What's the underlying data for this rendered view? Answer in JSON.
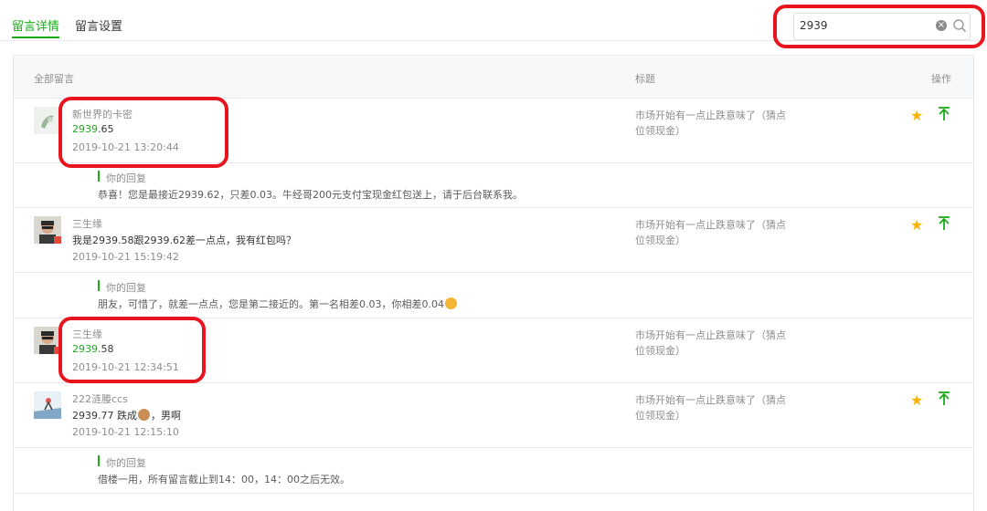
{
  "tabs": {
    "active": "留言详情",
    "settings": "留言设置"
  },
  "search": {
    "value": "2939"
  },
  "table_header": {
    "all_comments": "全部留言",
    "title": "标题",
    "actions": "操作"
  },
  "comments": [
    {
      "user": "新世界的卡密",
      "content_highlight": "2939",
      "content_rest": ".65",
      "time": "2019-10-21 13:20:44",
      "article": "市场开始有一点止跌意味了（猜点位领现金）",
      "reply_label": "你的回复",
      "reply": "恭喜！您是最接近2939.62，只差0.03。牛经哥200元支付宝现金红包送上，请于后台联系我。"
    },
    {
      "user": "三生缘",
      "content_highlight": "",
      "content_rest": "我是2939.58跟2939.62差一点点，我有红包吗？",
      "time": "2019-10-21 15:19:42",
      "article": "市场开始有一点止跌意味了（猜点位领现金）",
      "reply_label": "你的回复",
      "reply": "朋友，可惜了，就差一点点，您是第二接近的。第一名相差0.03，你相差0.04"
    },
    {
      "user": "三生缘",
      "content_highlight": "2939",
      "content_rest": ".58",
      "time": "2019-10-21 12:34:51",
      "article": "市场开始有一点止跌意味了（猜点位领现金）"
    },
    {
      "user": "222涟媵ccs",
      "content_highlight": "",
      "content_before_emoji": "2939.77 跌成",
      "content_after_emoji": "，男啊",
      "time": "2019-10-21 12:15:10",
      "article": "市场开始有一点止跌意味了（猜点位领现金）",
      "reply_label": "你的回复",
      "reply": "借楼一用，所有留言截止到14：00，14：00之后无效。"
    }
  ],
  "icons": {
    "star": "star-icon",
    "pin": "pin-to-top-icon",
    "search": "search-icon",
    "clear": "clear-icon"
  },
  "colors": {
    "accent": "#1aad19",
    "star": "#f4b400",
    "annotation": "#e8141e"
  }
}
